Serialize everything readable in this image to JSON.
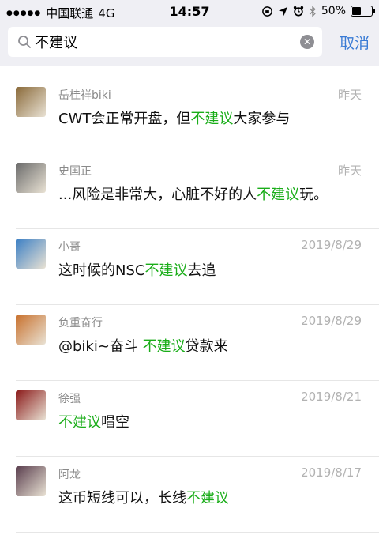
{
  "status_bar": {
    "carrier": "中国联通",
    "network": "4G",
    "time": "14:57",
    "battery": "50%",
    "battery_level": 0.5
  },
  "search": {
    "query": "不建议",
    "cancel_label": "取消"
  },
  "results": [
    {
      "name": "岳桂祥biki",
      "date": "昨天",
      "pre": "CWT会正常开盘，但",
      "keyword": "不建议",
      "post": "大家参与",
      "avatar_color": "#8a6a3a"
    },
    {
      "name": "史国正",
      "date": "昨天",
      "pre": "...风险是非常大，心脏不好的人",
      "keyword": "不建议",
      "post": "玩。",
      "avatar_color": "#6b6b6b"
    },
    {
      "name": "小哥",
      "date": "2019/8/29",
      "pre": "这时候的NSC",
      "keyword": "不建议",
      "post": "去追",
      "avatar_color": "#3b7fc4"
    },
    {
      "name": "负重奋行",
      "date": "2019/8/29",
      "pre": "@biki~奋斗 ",
      "keyword": "不建议",
      "post": "贷款来",
      "avatar_color": "#c8702c"
    },
    {
      "name": "徐强",
      "date": "2019/8/21",
      "pre": "",
      "keyword": "不建议",
      "post": "唱空",
      "avatar_color": "#8b1a1a"
    },
    {
      "name": "阿龙",
      "date": "2019/8/17",
      "pre": "这币短线可以，长线",
      "keyword": "不建议",
      "post": "",
      "avatar_color": "#5a3e4e"
    }
  ]
}
